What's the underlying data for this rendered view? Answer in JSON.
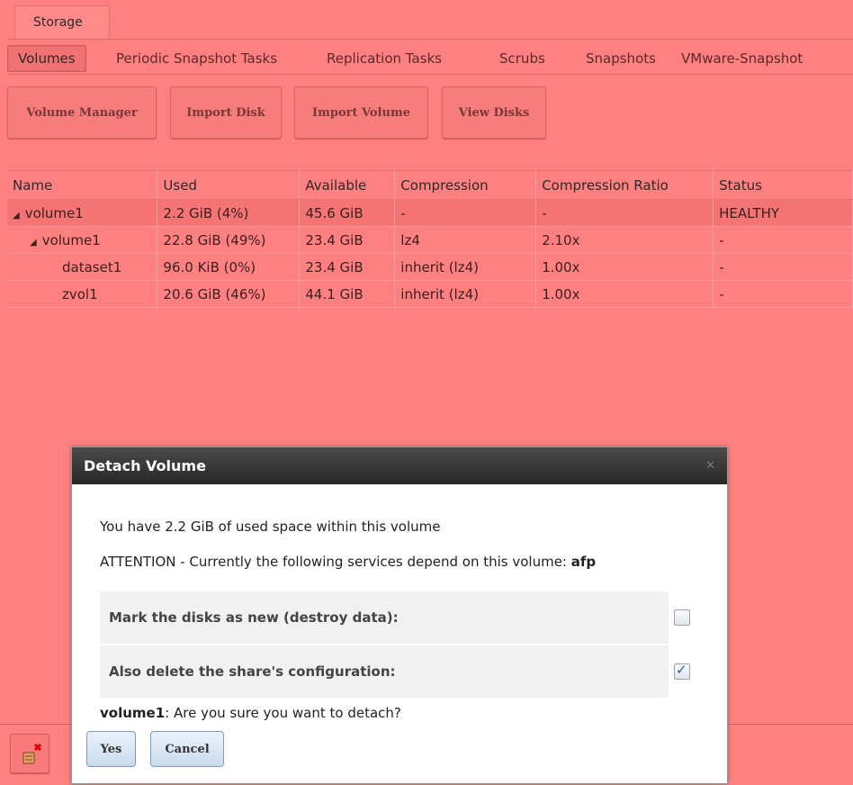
{
  "top_tab": "Storage",
  "subtabs": [
    "Volumes",
    "Periodic Snapshot Tasks",
    "Replication Tasks",
    "Scrubs",
    "Snapshots",
    "VMware-Snapshot"
  ],
  "toolbar": [
    "Volume Manager",
    "Import Disk",
    "Import Volume",
    "View Disks"
  ],
  "table": {
    "headers": [
      "Name",
      "Used",
      "Available",
      "Compression",
      "Compression Ratio",
      "Status"
    ],
    "rows": [
      {
        "name": "volume1",
        "used": "2.2 GiB (4%)",
        "available": "45.6 GiB",
        "compression": "-",
        "ratio": "-",
        "status": "HEALTHY"
      },
      {
        "name": "volume1",
        "used": "22.8 GiB (49%)",
        "available": "23.4 GiB",
        "compression": "lz4",
        "ratio": "2.10x",
        "status": "-"
      },
      {
        "name": "dataset1",
        "used": "96.0 KiB (0%)",
        "available": "23.4 GiB",
        "compression": "inherit (lz4)",
        "ratio": "1.00x",
        "status": "-"
      },
      {
        "name": "zvol1",
        "used": "20.6 GiB (46%)",
        "available": "44.1 GiB",
        "compression": "inherit (lz4)",
        "ratio": "1.00x",
        "status": "-"
      }
    ]
  },
  "dialog": {
    "title": "Detach Volume",
    "used_space_text": "You have 2.2 GiB of used space within this volume",
    "attention_text": "ATTENTION - Currently the following services depend on this volume: ",
    "attention_service": "afp",
    "field_mark_new": "Mark the disks as new (destroy data):",
    "field_delete_share": "Also delete the share's configuration:",
    "mark_new_checked": false,
    "delete_share_checked": true,
    "confirm_volume": "volume1",
    "confirm_text": ": Are you sure you want to detach?",
    "yes_label": "Yes",
    "cancel_label": "Cancel"
  },
  "icons": {
    "close": "close-icon",
    "detach": "detach-volume-icon",
    "expand": "expand-triangle-icon"
  }
}
